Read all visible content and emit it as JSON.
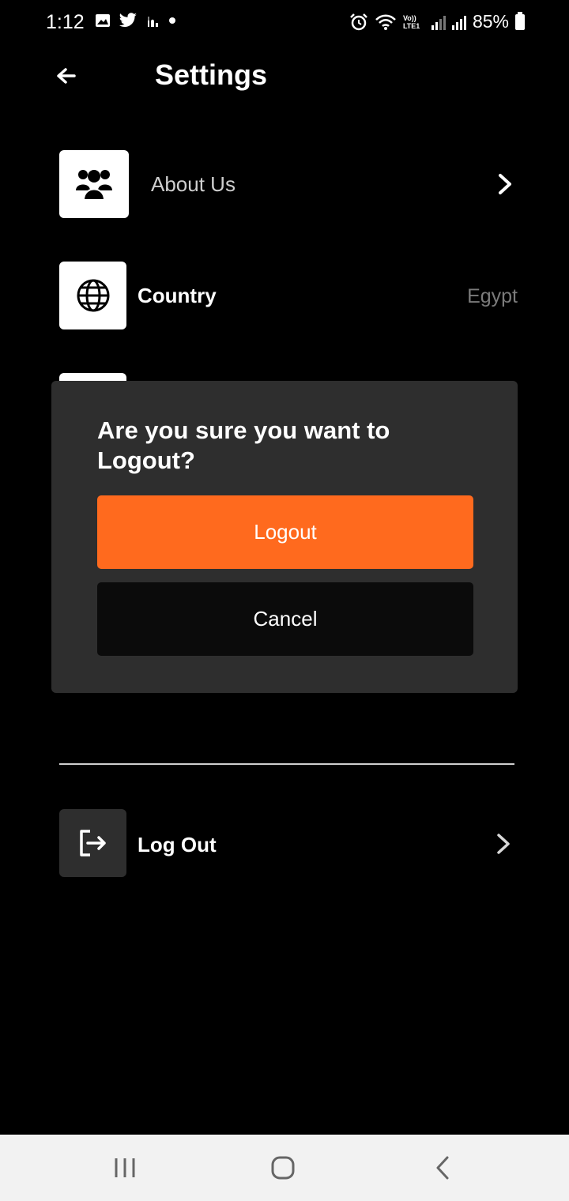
{
  "status_bar": {
    "time": "1:12",
    "network": "Vo)) LTE1",
    "battery": "85%",
    "icons": [
      "image-icon",
      "twitter-icon",
      "mosque-icon",
      "dot-icon",
      "alarm-icon",
      "wifi-icon",
      "signal-icon",
      "signal-icon",
      "battery-icon"
    ]
  },
  "header": {
    "title": "Settings",
    "back_icon": "arrow-left-icon"
  },
  "settings": {
    "about": {
      "label": "About Us",
      "icon": "users-icon"
    },
    "country": {
      "label": "Country",
      "value": "Egypt",
      "icon": "globe-icon"
    },
    "logout": {
      "label": "Log Out",
      "icon": "logout-icon"
    }
  },
  "dialog": {
    "title": "Are you sure you want to Logout?",
    "confirm_label": "Logout",
    "cancel_label": "Cancel"
  },
  "nav_bar": {
    "icons": [
      "recents-icon",
      "home-icon",
      "back-icon"
    ]
  },
  "colors": {
    "background": "#000000",
    "dialog": "#2e2e2e",
    "accent": "#ff6a1e",
    "cancel": "#0b0b0b"
  }
}
